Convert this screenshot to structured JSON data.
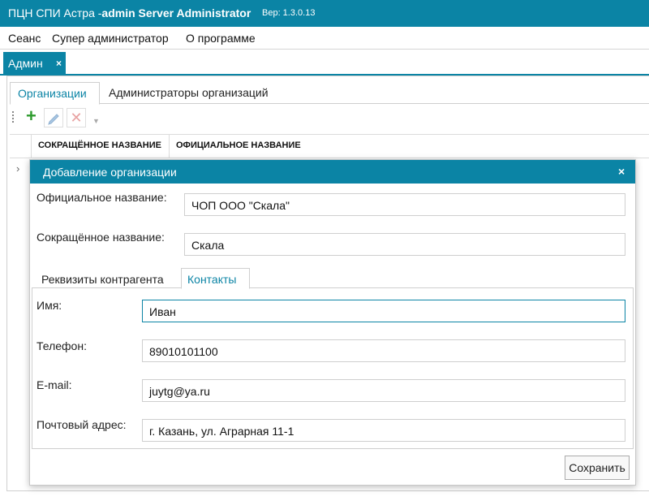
{
  "window": {
    "title_prefix": "ПЦН СПИ Астра -",
    "title_bold": "admin Server Administrator",
    "version": "Вер: 1.3.0.13"
  },
  "menu": {
    "items": [
      "Сеанс",
      "Супер администратор",
      "О программе"
    ]
  },
  "doc_tab": {
    "label": "Админ",
    "close": "×"
  },
  "sub_tabs": {
    "active": "Организации",
    "inactive": "Администраторы организаций"
  },
  "toolbar": {
    "add_icon": "plus-icon",
    "edit_icon": "pencil-icon",
    "delete_icon": "delete-icon"
  },
  "grid": {
    "columns": [
      "СОКРАЩЁННОЕ НАЗВАНИЕ",
      "ОФИЦИАЛЬНОЕ НАЗВАНИЕ"
    ],
    "row_arrow": "›"
  },
  "dialog": {
    "title": "Добавление организации",
    "close": "×",
    "official_name_label": "Официальное название:",
    "official_name_value": "ЧОП ООО \"Скала\"",
    "short_name_label": "Сокращённое название:",
    "short_name_value": "Скала",
    "tabs": {
      "requisites": "Реквизиты контрагента",
      "contacts": "Контакты"
    },
    "contacts": {
      "name_label": "Имя:",
      "name_value": "Иван",
      "phone_label": "Телефон:",
      "phone_value": "89010101100",
      "email_label": "E-mail:",
      "email_value": "juytg@ya.ru",
      "address_label": "Почтовый адрес:",
      "address_value": "г. Казань, ул. Аграрная 11-1"
    },
    "save_label": "Сохранить"
  },
  "colors": {
    "accent": "#0b84a5",
    "add_green": "#2e9b2e"
  }
}
